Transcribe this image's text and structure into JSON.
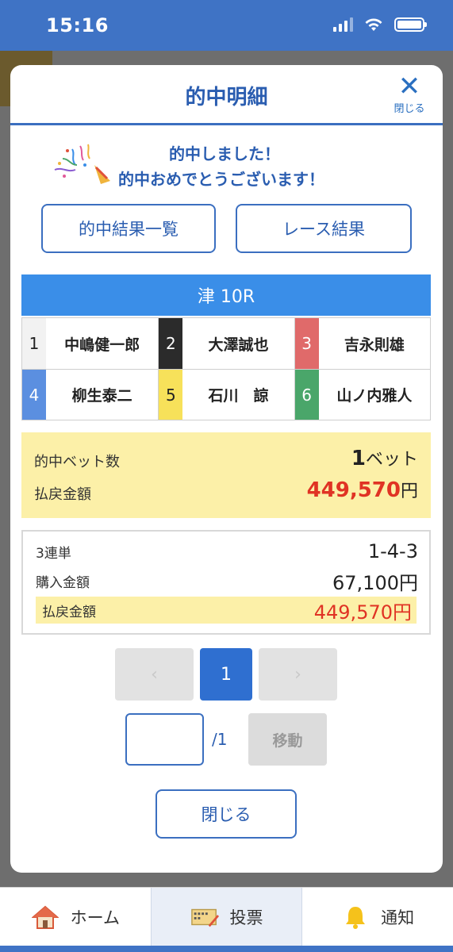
{
  "status_bar": {
    "time": "15:16"
  },
  "modal": {
    "title": "的中明細",
    "close_label": "閉じる",
    "congrats_line1": "的中しました！",
    "congrats_line2": "的中おめでとうございます！",
    "buttons": {
      "results_list": "的中結果一覧",
      "race_result": "レース結果"
    },
    "race": {
      "title": "津 10R",
      "racers": [
        {
          "num": "1",
          "name": "中嶋健一郎",
          "color": "#f2f2f2",
          "text_color": "#222222"
        },
        {
          "num": "2",
          "name": "大澤誠也",
          "color": "#2b2b2b",
          "text_color": "#ffffff"
        },
        {
          "num": "3",
          "name": "吉永則雄",
          "color": "#e06a6a",
          "text_color": "#ffffff"
        },
        {
          "num": "4",
          "name": "柳生泰二",
          "color": "#5b8fe0",
          "text_color": "#ffffff"
        },
        {
          "num": "5",
          "name": "石川　諒",
          "color": "#f7e15a",
          "text_color": "#222222"
        },
        {
          "num": "6",
          "name": "山ノ内雅人",
          "color": "#4aa66a",
          "text_color": "#ffffff"
        }
      ]
    },
    "summary": {
      "bet_count_label": "的中ベット数",
      "bet_count_value": "1",
      "bet_count_unit": "ベット",
      "payout_label": "払戻金額",
      "payout_value": "449,570",
      "payout_unit": "円"
    },
    "detail": {
      "bet_type": "3連単",
      "combination": "1-4-3",
      "purchase_label": "購入金額",
      "purchase_value": "67,100円",
      "payout_label": "払戻金額",
      "payout_value": "449,570円"
    },
    "pager": {
      "prev": "‹",
      "current": "1",
      "next": "›",
      "total": "/1",
      "move_label": "移動"
    },
    "close_button": "閉じる"
  },
  "tabbar": [
    {
      "label": "ホーム",
      "icon": "home-icon"
    },
    {
      "label": "投票",
      "icon": "ticket-icon",
      "active": true
    },
    {
      "label": "通知",
      "icon": "bell-icon"
    }
  ],
  "colors": {
    "accent": "#2a5db0",
    "race_header": "#3a8ee8",
    "highlight": "#fcf0a8",
    "payout": "#e03324"
  }
}
